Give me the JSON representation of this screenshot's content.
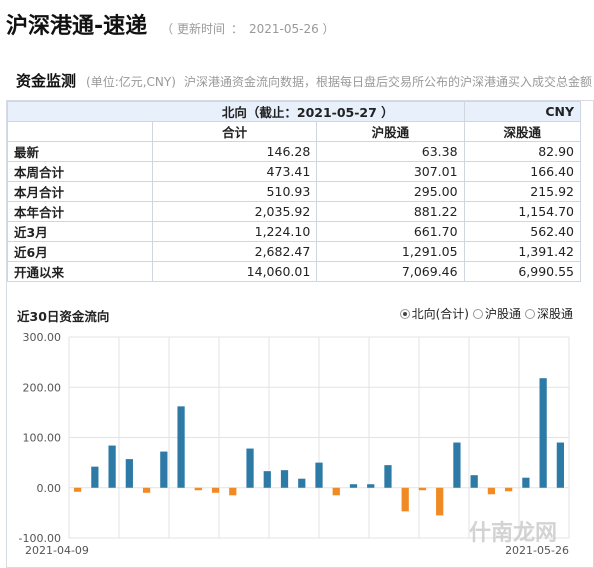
{
  "header": {
    "title": "沪深港通-速递",
    "updated_prefix": "（ 更新时间",
    "updated_colon": "：",
    "updated_date": "2021-05-26 ）"
  },
  "section": {
    "title": "资金监测",
    "unit": "(单位:亿元,CNY)",
    "description": "沪深港通资金流向数据，根据每日盘后交易所公布的沪深港通买入成交总金额"
  },
  "table": {
    "head_title": "北向（截止：2021-05-27 ）",
    "currency": "CNY",
    "columns": [
      "合计",
      "沪股通",
      "深股通"
    ],
    "rows": [
      {
        "label": "最新",
        "values": [
          "146.28",
          "63.38",
          "82.90"
        ]
      },
      {
        "label": "本周合计",
        "values": [
          "473.41",
          "307.01",
          "166.40"
        ]
      },
      {
        "label": "本月合计",
        "values": [
          "510.93",
          "295.00",
          "215.92"
        ]
      },
      {
        "label": "本年合计",
        "values": [
          "2,035.92",
          "881.22",
          "1,154.70"
        ]
      },
      {
        "label": "近3月",
        "values": [
          "1,224.10",
          "661.70",
          "562.40"
        ]
      },
      {
        "label": "近6月",
        "values": [
          "2,682.47",
          "1,291.05",
          "1,391.42"
        ]
      },
      {
        "label": "开通以来",
        "values": [
          "14,060.01",
          "7,069.46",
          "6,990.55"
        ]
      }
    ]
  },
  "chart_section": {
    "title": "近30日资金流向",
    "options": [
      {
        "label": "北向(合计)",
        "selected": true
      },
      {
        "label": "沪股通",
        "selected": false
      },
      {
        "label": "深股通",
        "selected": false
      }
    ]
  },
  "watermark": "什南龙网",
  "colors": {
    "positive": "#2e7aa6",
    "negative": "#f08a24",
    "grid": "#e3e3e3"
  },
  "chart_data": {
    "type": "bar",
    "title": "近30日资金流向",
    "xlabel": "",
    "ylabel": "",
    "ylim": [
      -100,
      300
    ],
    "yticks": [
      "300.00",
      "200.00",
      "100.00",
      "0.00",
      "-100.00"
    ],
    "x_start_label": "2021-04-09",
    "x_end_label": "2021-05-26",
    "values": [
      -8,
      42,
      84,
      57,
      -10,
      72,
      162,
      -5,
      -10,
      -15,
      78,
      33,
      35,
      18,
      50,
      -15,
      7,
      7,
      45,
      -47,
      -5,
      -55,
      90,
      25,
      -13,
      -7,
      20,
      218,
      90
    ]
  }
}
